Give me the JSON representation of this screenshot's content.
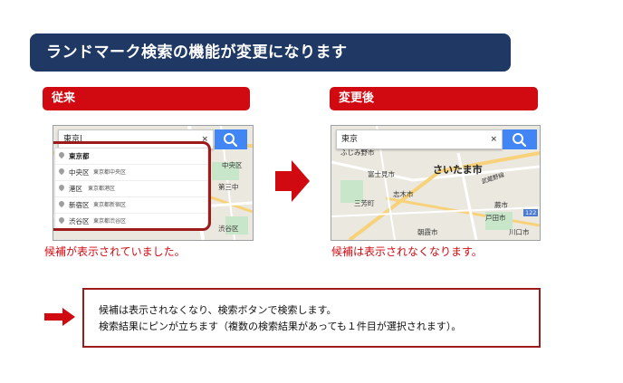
{
  "title": "ランドマーク検索の機能が変更になります",
  "before": {
    "header": "従来",
    "search_query": "東京|",
    "clear_symbol": "×",
    "suggestions": [
      {
        "name": "東京都",
        "sub": ""
      },
      {
        "name": "中央区",
        "sub": "東京都中央区"
      },
      {
        "name": "港区",
        "sub": "東京都港区"
      },
      {
        "name": "新宿区",
        "sub": "東京都新宿区"
      },
      {
        "name": "渋谷区",
        "sub": "東京都渋谷区"
      }
    ],
    "map_labels": [
      "中央区",
      "第三中",
      "渋谷区"
    ],
    "caption": "候補が表示されていました。"
  },
  "after": {
    "header": "変更後",
    "search_query": "東京",
    "clear_symbol": "×",
    "map_labels": [
      "ふじみ野市",
      "富士見市",
      "さいたま市",
      "志木市",
      "三芳町",
      "朝霞市",
      "蕨市",
      "戸田市",
      "川口市",
      "武蔵野線",
      "122"
    ],
    "caption": "候補は表示されなくなります。"
  },
  "notice": {
    "line1": "候補は表示されなくなり、検索ボタンで検索します。",
    "line2": "検索結果にピンが立ちます（複数の検索結果があっても１件目が選択されます）。"
  },
  "colors": {
    "title_bg": "#1f3864",
    "accent_red": "#d10a11",
    "frame_red": "#9e1b1b",
    "search_blue": "#4285f4"
  },
  "icons": [
    "search-icon",
    "clear-icon",
    "map-pin-icon",
    "right-arrow-icon"
  ]
}
